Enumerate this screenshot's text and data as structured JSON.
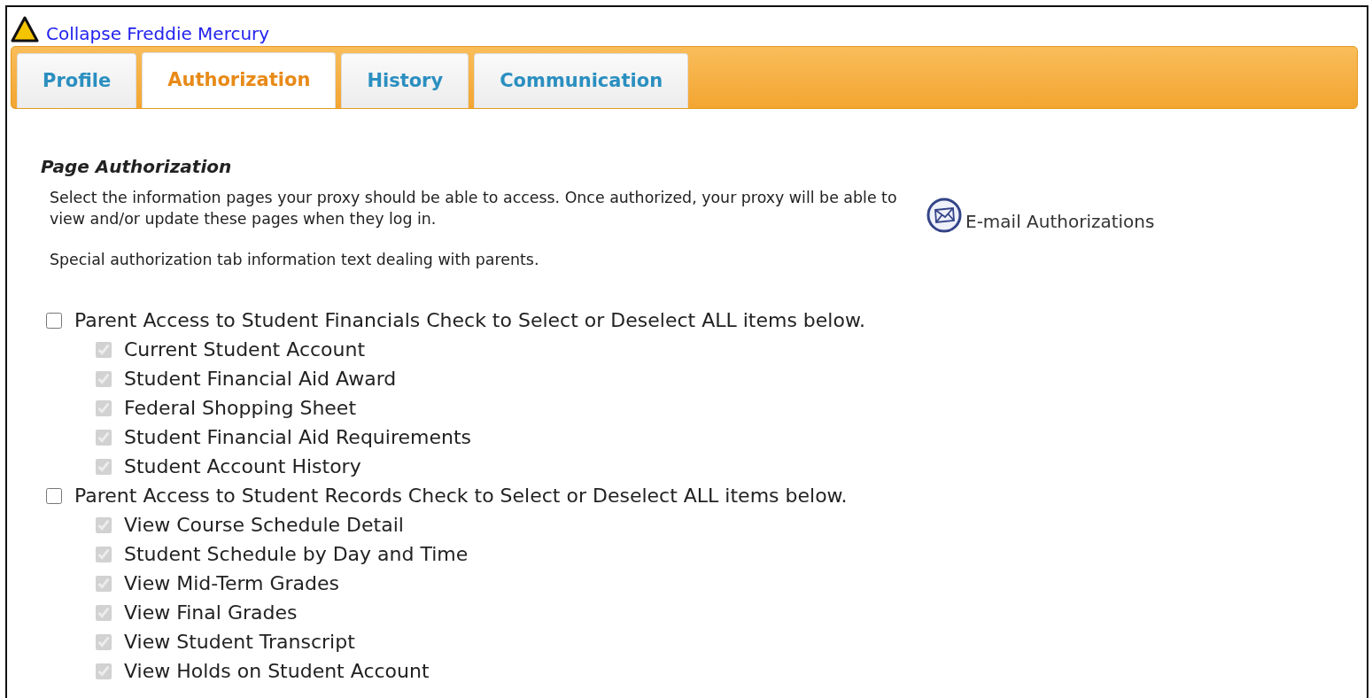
{
  "link": {
    "text": "Collapse Freddie Mercury"
  },
  "tabs": [
    {
      "label": "Profile",
      "selected": false
    },
    {
      "label": "Authorization",
      "selected": true
    },
    {
      "label": "History",
      "selected": false
    },
    {
      "label": "Communication",
      "selected": false
    }
  ],
  "section": {
    "title": "Page Authorization",
    "paragraphs": [
      "Select the information pages your proxy should be able to access. Once authorized, your proxy will be able to view and/or update these pages when they log in.",
      "Special authorization tab information text dealing with parents."
    ],
    "email_link": "E-mail Authorizations"
  },
  "groups": [
    {
      "label": "Parent Access to Student Financials Check to Select or Deselect ALL items below.",
      "checked": false,
      "items": [
        {
          "label": "Current Student Account",
          "checked": true,
          "disabled": true
        },
        {
          "label": "Student Financial Aid Award",
          "checked": true,
          "disabled": true
        },
        {
          "label": "Federal Shopping Sheet",
          "checked": true,
          "disabled": true
        },
        {
          "label": "Student Financial Aid Requirements",
          "checked": true,
          "disabled": true
        },
        {
          "label": "Student Account History",
          "checked": true,
          "disabled": true
        }
      ]
    },
    {
      "label": "Parent Access to Student Records Check to Select or Deselect ALL items below.",
      "checked": false,
      "items": [
        {
          "label": "View Course Schedule Detail",
          "checked": true,
          "disabled": true
        },
        {
          "label": "Student Schedule by Day and Time",
          "checked": true,
          "disabled": true
        },
        {
          "label": "View Mid-Term Grades",
          "checked": true,
          "disabled": true
        },
        {
          "label": "View Final Grades",
          "checked": true,
          "disabled": true
        },
        {
          "label": "View Student Transcript",
          "checked": true,
          "disabled": true
        },
        {
          "label": "View Holds on Student Account",
          "checked": true,
          "disabled": true
        }
      ]
    }
  ]
}
